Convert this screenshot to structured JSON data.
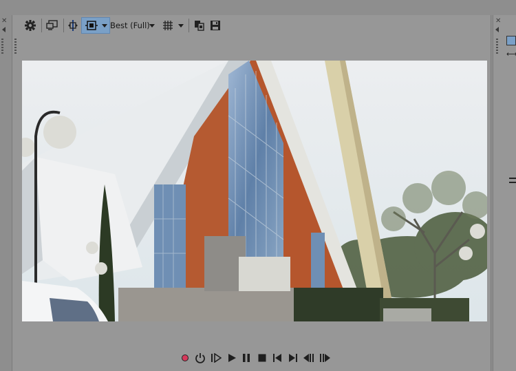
{
  "toolbar": {
    "quality_label": "Best (Full)",
    "items": [
      {
        "name": "settings-gear-icon",
        "interactable": true
      },
      {
        "name": "external-monitor-icon",
        "interactable": true
      },
      {
        "name": "split-screen-view-icon",
        "interactable": true
      },
      {
        "name": "overlays-icon",
        "interactable": true,
        "active": true
      },
      {
        "name": "preview-quality-dropdown",
        "interactable": true
      },
      {
        "name": "grid-overlay-icon",
        "interactable": true
      },
      {
        "name": "copy-snapshot-icon",
        "interactable": true
      },
      {
        "name": "save-snapshot-icon",
        "interactable": true
      }
    ]
  },
  "transport": {
    "buttons": [
      "record-icon",
      "loop-playback-icon",
      "play-from-start-icon",
      "play-icon",
      "pause-icon",
      "stop-icon",
      "previous-frame-icon",
      "next-frame-icon",
      "go-to-start-icon",
      "go-to-end-icon"
    ]
  },
  "colors": {
    "panel_bg": "#979797",
    "active_button": "#7aa0c7",
    "record_red": "#d63a5c",
    "sky": "#eef1f2",
    "brick": "#b5562d",
    "glass_blue": "#6f8fb4"
  }
}
